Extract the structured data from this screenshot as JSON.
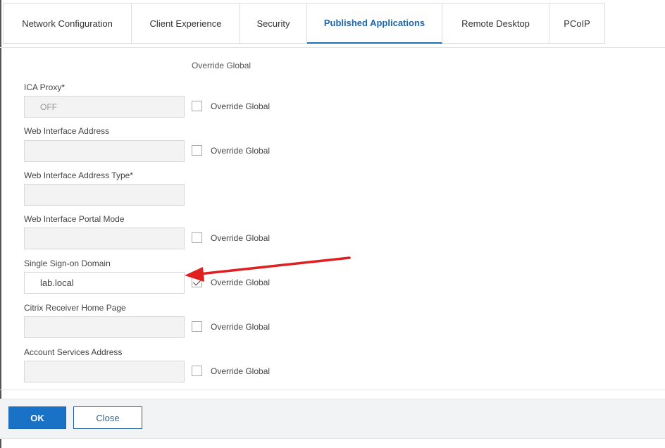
{
  "tabs": [
    {
      "label": "Network Configuration",
      "active": false
    },
    {
      "label": "Client Experience",
      "active": false
    },
    {
      "label": "Security",
      "active": false
    },
    {
      "label": "Published Applications",
      "active": true
    },
    {
      "label": "Remote Desktop",
      "active": false
    },
    {
      "label": "PCoIP",
      "active": false
    }
  ],
  "column_header": "Override Global",
  "fields": [
    {
      "label": "ICA Proxy*",
      "value": "OFF",
      "override": {
        "label": "Override Global",
        "checked": false
      }
    },
    {
      "label": "Web Interface Address",
      "value": "",
      "override": {
        "label": "Override Global",
        "checked": false
      }
    },
    {
      "label": "Web Interface Address Type*",
      "value": ""
    },
    {
      "label": "Web Interface Portal Mode",
      "value": "",
      "override": {
        "label": "Override Global",
        "checked": false
      }
    },
    {
      "label": "Single Sign-on Domain",
      "value": "lab.local",
      "override": {
        "label": "Override Global",
        "checked": true
      }
    },
    {
      "label": "Citrix Receiver Home Page",
      "value": "",
      "override": {
        "label": "Override Global",
        "checked": false
      }
    },
    {
      "label": "Account Services Address",
      "value": "",
      "override": {
        "label": "Override Global",
        "checked": false
      }
    }
  ],
  "buttons": {
    "ok": "OK",
    "close": "Close"
  },
  "annotation": {
    "color": "#e02020",
    "icon": "red-arrow-pointer"
  },
  "colors": {
    "accent": "#1a72c6",
    "active_tab_text": "#2266aa"
  }
}
